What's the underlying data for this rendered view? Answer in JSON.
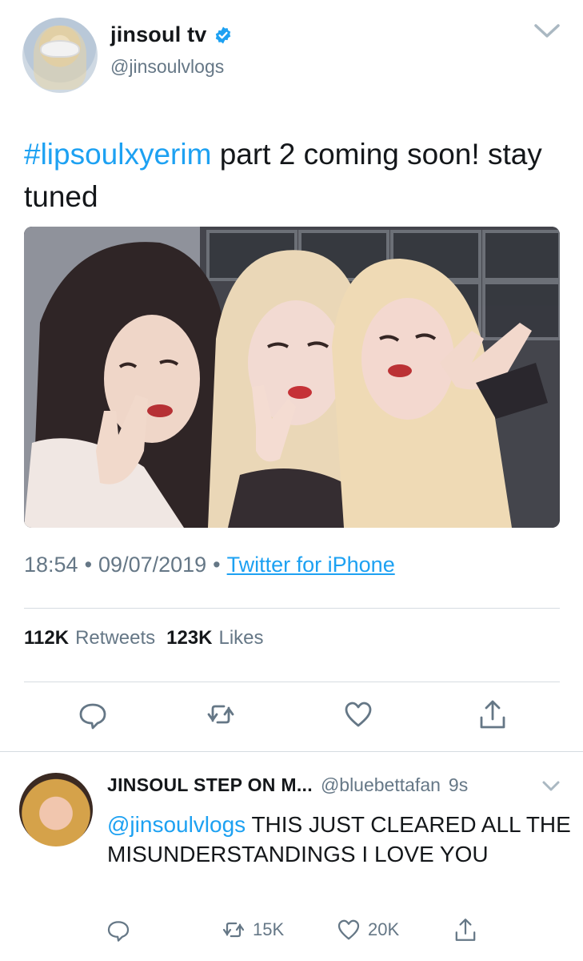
{
  "tweet": {
    "display_name": "jinsoul tv",
    "handle": "@jinsoulvlogs",
    "hashtag": "#lipsoulxyerim",
    "text_rest": " part 2 coming soon! stay tuned",
    "time": "18:54",
    "date": "09/07/2019",
    "source": "Twitter for iPhone",
    "separator": "•",
    "retweets_count": "112K",
    "retweets_label": "Retweets",
    "likes_count": "123K",
    "likes_label": "Likes"
  },
  "reply": {
    "display_name": "JINSOUL STEP ON M...",
    "handle": "@bluebettafan",
    "time": "9s",
    "mention": "@jinsoulvlogs",
    "text_rest": " THIS JUST CLEARED ALL THE MISUNDERSTANDINGS I LOVE YOU",
    "retweets_count": "15K",
    "likes_count": "20K"
  },
  "colors": {
    "link": "#1da1f2",
    "secondary_text": "#657786",
    "primary_text": "#14171a",
    "divider": "#d6dce1"
  },
  "icons": {
    "verified": "verified-badge-icon",
    "chevron": "chevron-down-icon",
    "reply": "reply-icon",
    "retweet": "retweet-icon",
    "like": "heart-icon",
    "share": "share-icon"
  }
}
